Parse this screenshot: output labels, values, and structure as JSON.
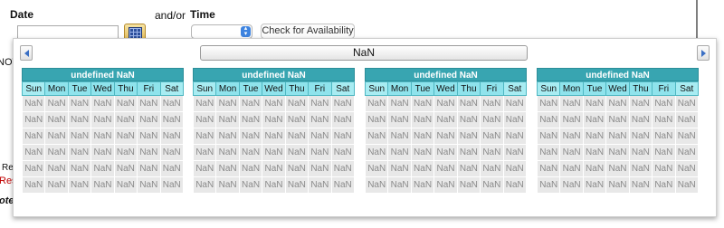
{
  "form": {
    "date_label": "Date",
    "andor_label": "and/or",
    "time_label": "Time",
    "date_value": "",
    "time_value": "",
    "availability_button": "Check for Availability"
  },
  "background_fragments": {
    "not_text": "NOT",
    "res_text": "Res",
    "rest_text": "Rest",
    "note_text": "ote:"
  },
  "calendar": {
    "title": "NaN",
    "prev_icon": "triangle-left-icon",
    "next_icon": "triangle-right-icon",
    "weekdays": [
      "Sun",
      "Mon",
      "Tue",
      "Wed",
      "Thu",
      "Fri",
      "Sat"
    ],
    "months": [
      {
        "header": "undefined NaN"
      },
      {
        "header": "undefined NaN"
      },
      {
        "header": "undefined NaN"
      },
      {
        "header": "undefined NaN"
      }
    ],
    "day_value": "NaN",
    "rows_per_month": 6
  },
  "colors": {
    "month_header": "#38a5b1",
    "weekday_header": "#8fe3ec",
    "day_cell": "#e8e8e8",
    "nav_arrow": "#3a6fc4"
  }
}
